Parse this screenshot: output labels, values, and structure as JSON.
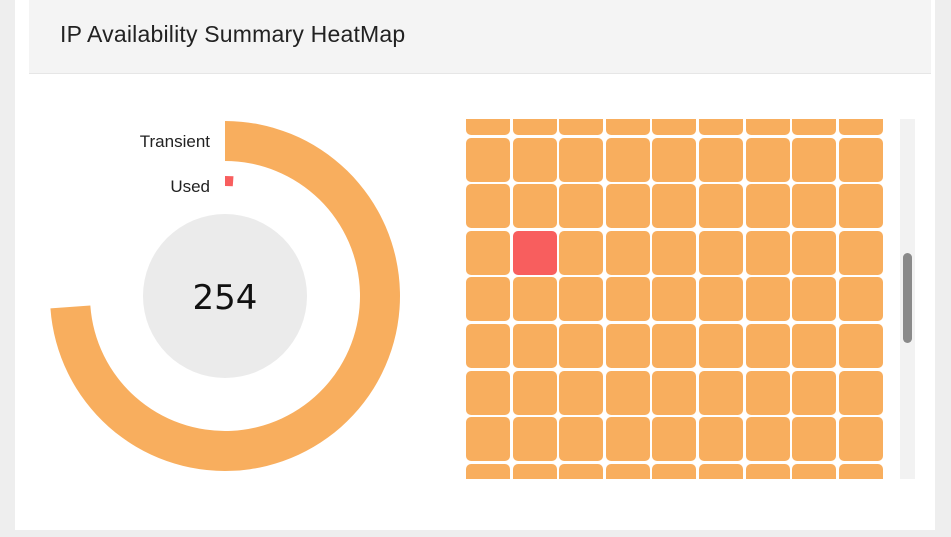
{
  "widget": {
    "title": "IP Availability Summary HeatMap"
  },
  "donut": {
    "total": "254",
    "segments": [
      {
        "label": "Transient",
        "value": 0.985,
        "color": "#f8ae5e"
      },
      {
        "label": "Used",
        "value": 0.015,
        "color": "#f85e5e"
      }
    ],
    "center_color": "#ebebeb"
  },
  "heatmap": {
    "columns": 9,
    "visible_rows": 9,
    "used_cell": {
      "row": 3,
      "col": 1
    },
    "colors": {
      "available": "#f8ae5e",
      "used": "#f85e5e"
    }
  },
  "scrollbar": {
    "position": 0.37
  }
}
